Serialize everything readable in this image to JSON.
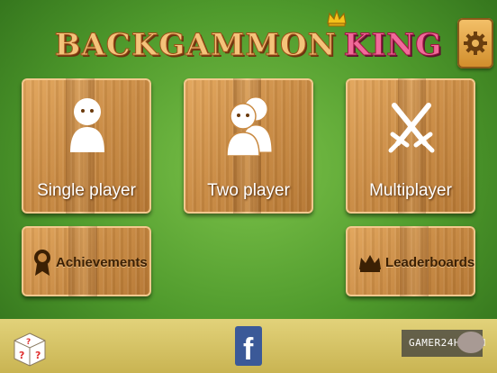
{
  "header": {
    "title_part1": "BACKGAMMON",
    "title_part2": "KING",
    "settings_icon": "gear-icon"
  },
  "menu": {
    "single_player": {
      "label": "Single player",
      "icon": "person-icon"
    },
    "two_player": {
      "label": "Two player",
      "icon": "two-people-icon"
    },
    "multiplayer": {
      "label": "Multiplayer",
      "icon": "crossed-swords-icon"
    },
    "achievements": {
      "label": "Achievements",
      "icon": "medal-icon"
    },
    "leaderboards": {
      "label": "Leaderboards",
      "icon": "crown-icon"
    }
  },
  "footer": {
    "facebook_letter": "f",
    "watermark": "GAMER24H.COM",
    "dice_icon": "mystery-dice-icon",
    "chat_icon": "chat-bubble-icon"
  },
  "colors": {
    "background": "#5aa534",
    "wood": "#c98a42",
    "title_gold": "#f4c37a",
    "title_pink": "#f06a9a",
    "facebook": "#3b5998",
    "bottom_bar": "#d8c868"
  }
}
